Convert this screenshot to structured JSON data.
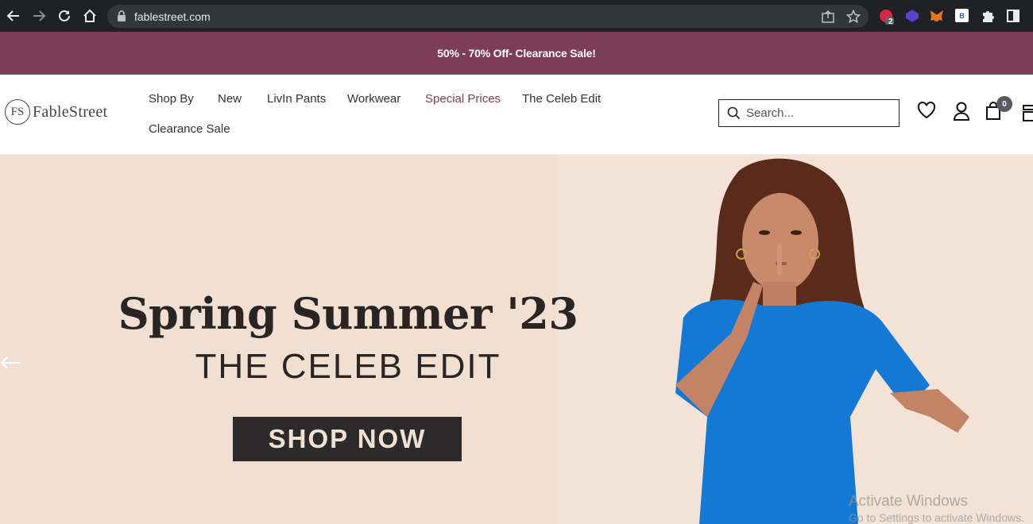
{
  "browser": {
    "url": "fablestreet.com",
    "extension_badge": "2",
    "extension_label_b": "B"
  },
  "promo": {
    "text": "50% - 70% Off- Clearance Sale!"
  },
  "header": {
    "logo_mark": "FS",
    "logo_text": "FableStreet",
    "nav": [
      {
        "label": "Shop By"
      },
      {
        "label": "New"
      },
      {
        "label": "LivIn Pants"
      },
      {
        "label": "Workwear"
      },
      {
        "label": "Special Prices"
      },
      {
        "label": "The Celeb Edit"
      },
      {
        "label": "Clearance Sale"
      }
    ],
    "search_placeholder": "Search...",
    "cart_count": "0"
  },
  "hero": {
    "title": "Spring Summer '23",
    "subtitle": "THE CELEB EDIT",
    "cta": "SHOP NOW"
  },
  "watermark": {
    "line1": "Activate Windows",
    "line2": "Go to Settings to activate Windows."
  },
  "colors": {
    "brand": "#7d3d56",
    "hero_bg": "#f1dfd2",
    "cta_bg": "#2c2a2a",
    "dress_blue": "#1479d4"
  }
}
